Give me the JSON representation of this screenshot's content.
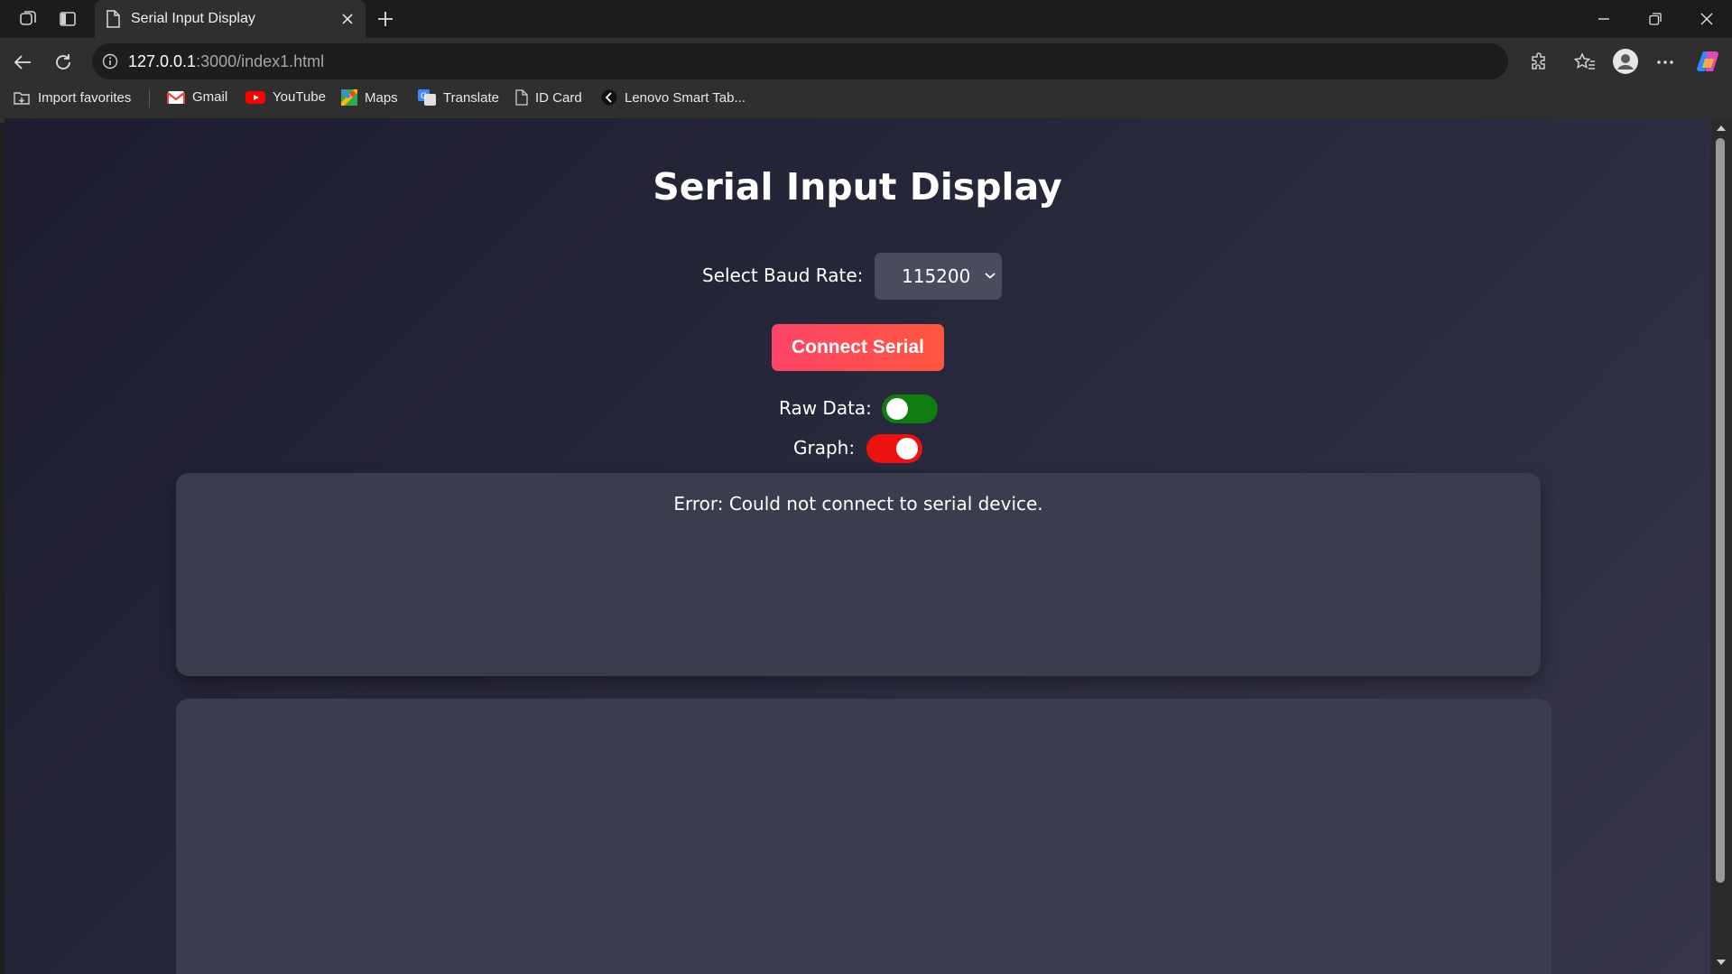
{
  "browser": {
    "tab_title": "Serial Input Display",
    "url_host": "127.0.0.1",
    "url_rest": ":3000/index1.html",
    "bookmarks": [
      "Import favorites",
      "Gmail",
      "YouTube",
      "Maps",
      "Translate",
      "ID Card",
      "Lenovo Smart Tab..."
    ]
  },
  "page": {
    "title": "Serial Input Display",
    "baud_label": "Select Baud Rate:",
    "baud_value": "115200",
    "connect_label": "Connect Serial",
    "raw_data_label": "Raw Data:",
    "graph_label": "Graph:",
    "raw_toggle_color": "#0f7d0f",
    "graph_toggle_color": "#ee1111",
    "error_message": "Error: Could not connect to serial device."
  }
}
